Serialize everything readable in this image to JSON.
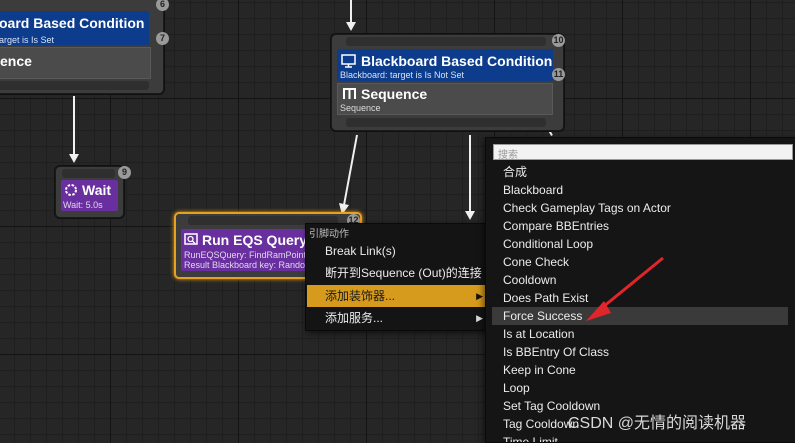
{
  "nodes": {
    "left_node": {
      "decorator_title": "oard Based Condition",
      "decorator_sub": "arget is Is Set",
      "composite_title": "ence",
      "badge_top": "6",
      "badge_mid": "7"
    },
    "right_node": {
      "decorator_title": "Blackboard Based Condition",
      "decorator_sub": "Blackboard: target is Is Not Set",
      "composite_title": "Sequence",
      "composite_sub": "Sequence",
      "badge_top": "10",
      "badge_mid": "11"
    },
    "wait_node": {
      "title": "Wait",
      "sub": "Wait: 5.0s",
      "badge": "9"
    },
    "eqs_node": {
      "title": "Run EQS Query",
      "sub1": "RunEQSQuery: FindRamPoint",
      "sub2": "Result Blackboard key: Random",
      "badge": "12"
    }
  },
  "context_menu": {
    "header": "引脚动作",
    "items": [
      {
        "label": "Break Link(s)"
      },
      {
        "label": "断开到Sequence (Out)的连接"
      },
      {
        "label": "添加装饰器...",
        "chevron": "▶"
      },
      {
        "label": "添加服务...",
        "chevron": "▶"
      }
    ]
  },
  "submenu": {
    "search_placeholder": "搜索",
    "items": [
      {
        "label": "合成"
      },
      {
        "label": "Blackboard"
      },
      {
        "label": "Check Gameplay Tags on Actor"
      },
      {
        "label": "Compare BBEntries"
      },
      {
        "label": "Conditional Loop"
      },
      {
        "label": "Cone Check"
      },
      {
        "label": "Cooldown"
      },
      {
        "label": "Does Path Exist"
      },
      {
        "label": "Force Success"
      },
      {
        "label": "Is at Location"
      },
      {
        "label": "Is BBEntry Of Class"
      },
      {
        "label": "Keep in Cone"
      },
      {
        "label": "Loop"
      },
      {
        "label": "Set Tag Cooldown"
      },
      {
        "label": "Tag Cooldown"
      },
      {
        "label": "Time Limit"
      }
    ],
    "highlighted_index": 8
  },
  "watermark": "CSDN @无情的阅读机器",
  "colors": {
    "decorator_blue": "#0d3c8c",
    "task_purple": "#6a2f9e",
    "selected_orange": "#e8a020",
    "menu_active": "#d69a1c",
    "red_arrow": "#e0262a"
  },
  "icons": {
    "decorator": "monitor-icon",
    "composite": "sequence-icon",
    "wait": "gear-icon",
    "eqs": "query-icon"
  }
}
